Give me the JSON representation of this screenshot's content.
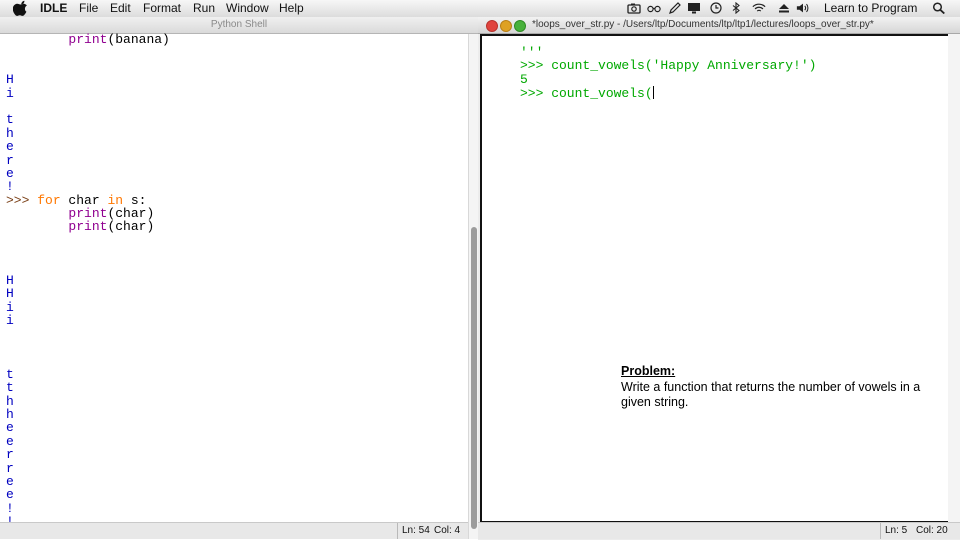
{
  "menubar": {
    "app_name": "IDLE",
    "items": [
      "File",
      "Edit",
      "Format",
      "Run",
      "Window",
      "Help"
    ],
    "right_title": "Learn to Program",
    "tray_icons": [
      "camera-icon",
      "glasses-icon",
      "pen-icon",
      "display-icon",
      "clock-icon",
      "bluetooth-icon",
      "wifi-icon",
      "eject-icon",
      "volume-icon",
      "spotlight-icon"
    ]
  },
  "shell": {
    "title": "Python Shell",
    "lines": [
      {
        "segs": [
          {
            "t": "        "
          },
          {
            "t": "print",
            "c": "bi"
          },
          {
            "t": "(banana)"
          }
        ]
      },
      {
        "segs": []
      },
      {
        "segs": []
      },
      {
        "segs": [
          {
            "t": "H",
            "c": "out"
          }
        ]
      },
      {
        "segs": [
          {
            "t": "i",
            "c": "out"
          }
        ]
      },
      {
        "segs": []
      },
      {
        "segs": [
          {
            "t": "t",
            "c": "out"
          }
        ]
      },
      {
        "segs": [
          {
            "t": "h",
            "c": "out"
          }
        ]
      },
      {
        "segs": [
          {
            "t": "e",
            "c": "out"
          }
        ]
      },
      {
        "segs": [
          {
            "t": "r",
            "c": "out"
          }
        ]
      },
      {
        "segs": [
          {
            "t": "e",
            "c": "out"
          }
        ]
      },
      {
        "segs": [
          {
            "t": "!",
            "c": "out"
          }
        ]
      },
      {
        "segs": [
          {
            "t": ">>> ",
            "c": "prompt"
          },
          {
            "t": "for",
            "c": "kw"
          },
          {
            "t": " char "
          },
          {
            "t": "in",
            "c": "kw"
          },
          {
            "t": " s:"
          }
        ]
      },
      {
        "segs": [
          {
            "t": "        "
          },
          {
            "t": "print",
            "c": "bi"
          },
          {
            "t": "(char)"
          }
        ]
      },
      {
        "segs": [
          {
            "t": "        "
          },
          {
            "t": "print",
            "c": "bi"
          },
          {
            "t": "(char)"
          }
        ]
      },
      {
        "segs": []
      },
      {
        "segs": []
      },
      {
        "segs": []
      },
      {
        "segs": [
          {
            "t": "H",
            "c": "out"
          }
        ]
      },
      {
        "segs": [
          {
            "t": "H",
            "c": "out"
          }
        ]
      },
      {
        "segs": [
          {
            "t": "i",
            "c": "out"
          }
        ]
      },
      {
        "segs": [
          {
            "t": "i",
            "c": "out"
          }
        ]
      },
      {
        "segs": []
      },
      {
        "segs": []
      },
      {
        "segs": []
      },
      {
        "segs": [
          {
            "t": "t",
            "c": "out"
          }
        ]
      },
      {
        "segs": [
          {
            "t": "t",
            "c": "out"
          }
        ]
      },
      {
        "segs": [
          {
            "t": "h",
            "c": "out"
          }
        ]
      },
      {
        "segs": [
          {
            "t": "h",
            "c": "out"
          }
        ]
      },
      {
        "segs": [
          {
            "t": "e",
            "c": "out"
          }
        ]
      },
      {
        "segs": [
          {
            "t": "e",
            "c": "out"
          }
        ]
      },
      {
        "segs": [
          {
            "t": "r",
            "c": "out"
          }
        ]
      },
      {
        "segs": [
          {
            "t": "r",
            "c": "out"
          }
        ]
      },
      {
        "segs": [
          {
            "t": "e",
            "c": "out"
          }
        ]
      },
      {
        "segs": [
          {
            "t": "e",
            "c": "out"
          }
        ]
      },
      {
        "segs": [
          {
            "t": "!",
            "c": "out"
          }
        ]
      },
      {
        "segs": [
          {
            "t": "!",
            "c": "out"
          }
        ]
      },
      {
        "segs": [
          {
            "t": ">>>",
            "c": "prompt"
          }
        ]
      }
    ],
    "status": {
      "line": "Ln: 54",
      "col": "Col: 4"
    }
  },
  "editor": {
    "title": "*loops_over_str.py - /Users/ltp/Documents/ltp/ltp1/lectures/loops_over_str.py*",
    "lines": [
      {
        "segs": [
          {
            "t": "'''",
            "c": "green"
          }
        ]
      },
      {
        "segs": [
          {
            "t": ">>> count_vowels('Happy Anniversary!')",
            "c": "green"
          }
        ]
      },
      {
        "segs": [
          {
            "t": "5",
            "c": "green"
          }
        ]
      },
      {
        "segs": [
          {
            "t": ">>> count_vowels(",
            "c": "green"
          }
        ],
        "cursor": true
      }
    ],
    "status": {
      "line": "Ln: 5",
      "col": "Col: 20"
    }
  },
  "problem": {
    "title": "Problem:",
    "text": "Write a function that returns the number of vowels in a given string."
  },
  "colors": {
    "prompt": "#7a3f16",
    "keyword": "#ff7700",
    "builtin": "#900090",
    "output": "#0000c0",
    "string": "#00a800"
  }
}
